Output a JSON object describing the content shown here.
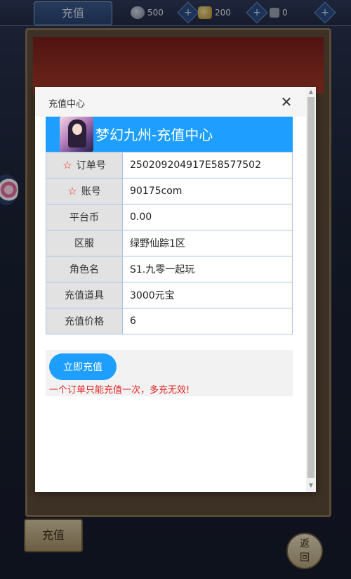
{
  "game": {
    "top_title": "充值",
    "resources": [
      {
        "icon": "silver-coin-icon",
        "value": "500"
      },
      {
        "icon": "gold-ingot-icon",
        "value": "200"
      },
      {
        "icon": "currency-icon",
        "value": "0"
      }
    ],
    "bottom_button": "充值",
    "back_button_top": "返",
    "back_button_bottom": "回"
  },
  "modal": {
    "title": "充值中心",
    "close_symbol": "✕",
    "banner_title": "梦幻九州-充值中心",
    "rows": [
      {
        "label": "订单号",
        "value": "250209204917E58577502",
        "required": true
      },
      {
        "label": "账号",
        "value": "90175com",
        "required": true
      },
      {
        "label": "平台币",
        "value": "0.00",
        "required": false
      },
      {
        "label": "区服",
        "value": "绿野仙踪1区",
        "required": false
      },
      {
        "label": "角色名",
        "value": "S1.九零一起玩",
        "required": false
      },
      {
        "label": "充值道具",
        "value": "3000元宝",
        "required": false
      },
      {
        "label": "充值价格",
        "value": "6",
        "required": false
      }
    ],
    "required_mark": "☆",
    "pay_button": "立即充值",
    "warning": "一个订单只能充值一次，多充无效!"
  },
  "colors": {
    "accent": "#1e9fff",
    "warning": "#e02020",
    "table_border": "#a9c4e8"
  }
}
